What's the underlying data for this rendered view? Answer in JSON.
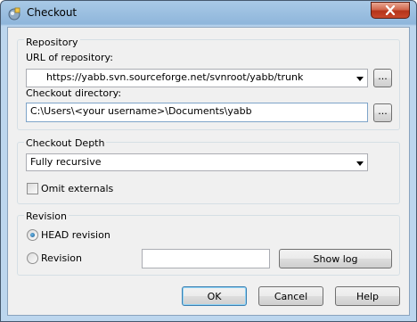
{
  "window": {
    "title": "Checkout",
    "close_icon": "close-icon",
    "app_icon": "tortoisesvn-checkout-icon",
    "accent_close": "#c8482c"
  },
  "repository": {
    "group_title": "Repository",
    "url_label": "URL of repository:",
    "url_value": "https://yabb.svn.sourceforge.net/svnroot/yabb/trunk",
    "browse_label": "...",
    "dir_label": "Checkout directory:",
    "dir_value": "C:\\Users\\<your username>\\Documents\\yabb",
    "dir_browse_label": "..."
  },
  "depth": {
    "group_title": "Checkout Depth",
    "selected": "Fully recursive",
    "omit_externals_label": "Omit externals",
    "omit_externals_checked": false
  },
  "revision": {
    "group_title": "Revision",
    "head_label": "HEAD revision",
    "head_selected": true,
    "revision_label": "Revision",
    "revision_value": "",
    "show_log_label": "Show log"
  },
  "buttons": {
    "ok": "OK",
    "cancel": "Cancel",
    "help": "Help"
  }
}
